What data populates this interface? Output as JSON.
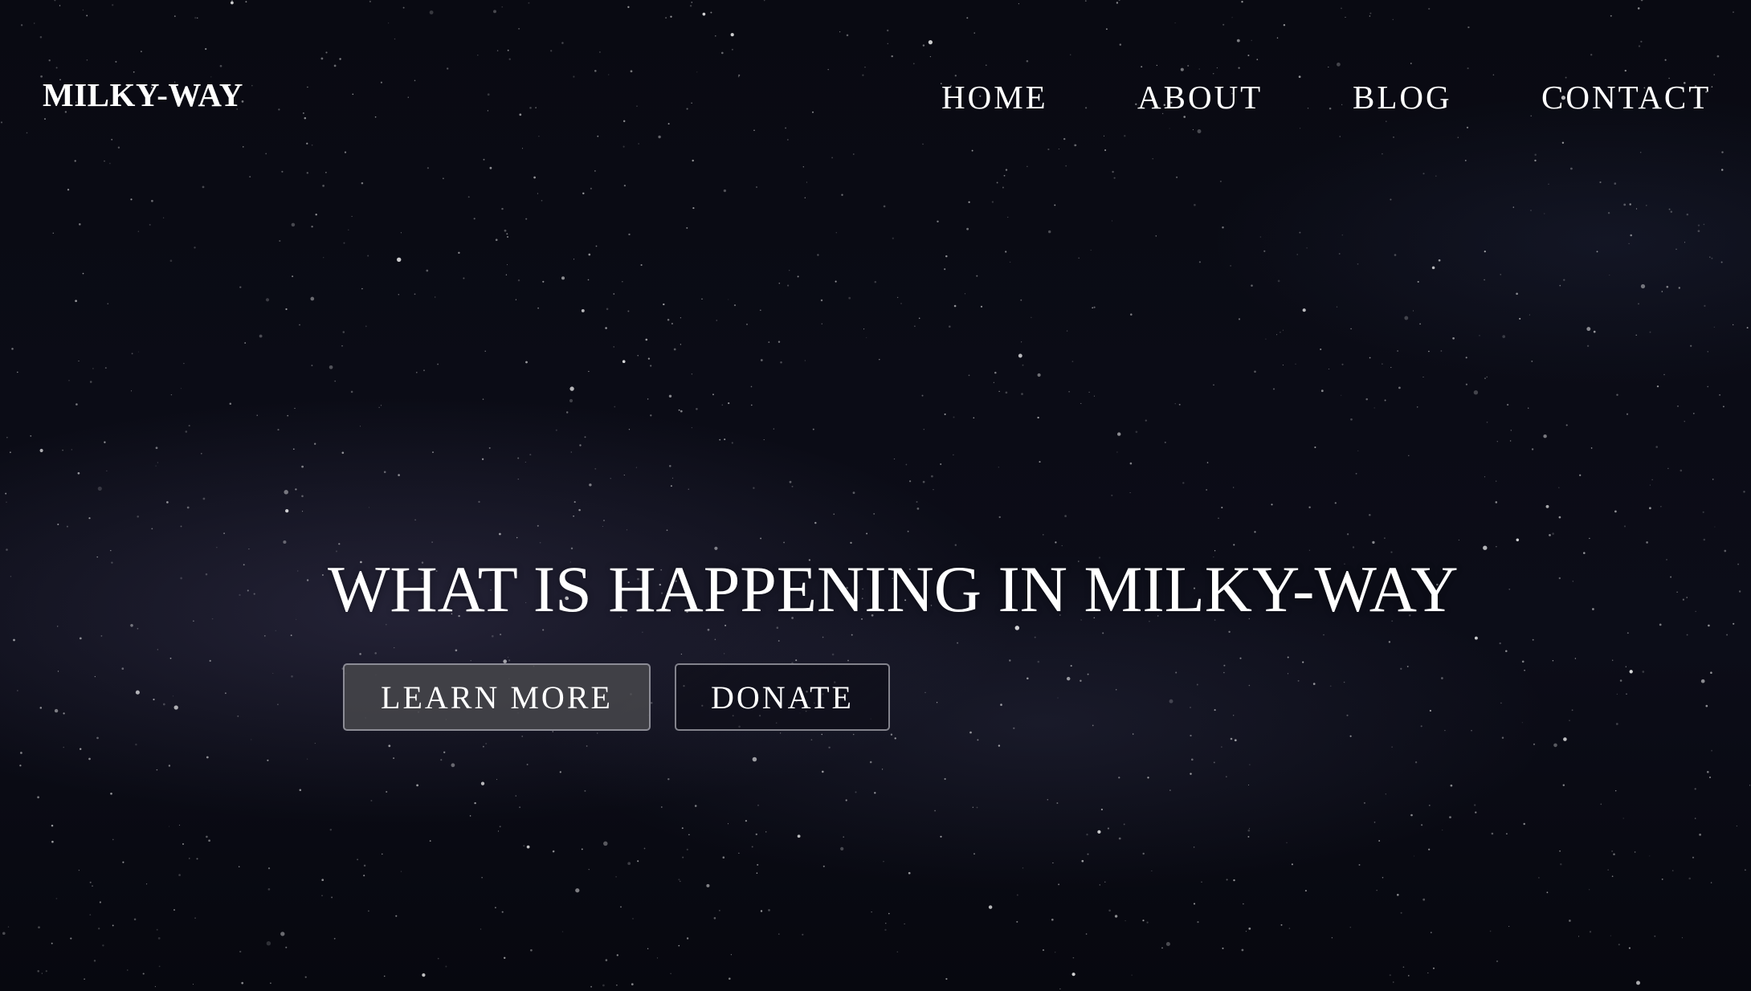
{
  "header": {
    "brand": "MILKY-WAY",
    "nav": {
      "home": "HOME",
      "about": "ABOUT",
      "blog": "BLOG",
      "contact": "CONTACT"
    }
  },
  "hero": {
    "title": "WHAT IS HAPPENING IN MILKY-WAY",
    "buttons": {
      "learn_more": "LEARN MORE",
      "donate": "DONATE"
    }
  },
  "colors": {
    "text": "#ffffff",
    "background": "#090a12",
    "primary_button": "#46464a"
  }
}
